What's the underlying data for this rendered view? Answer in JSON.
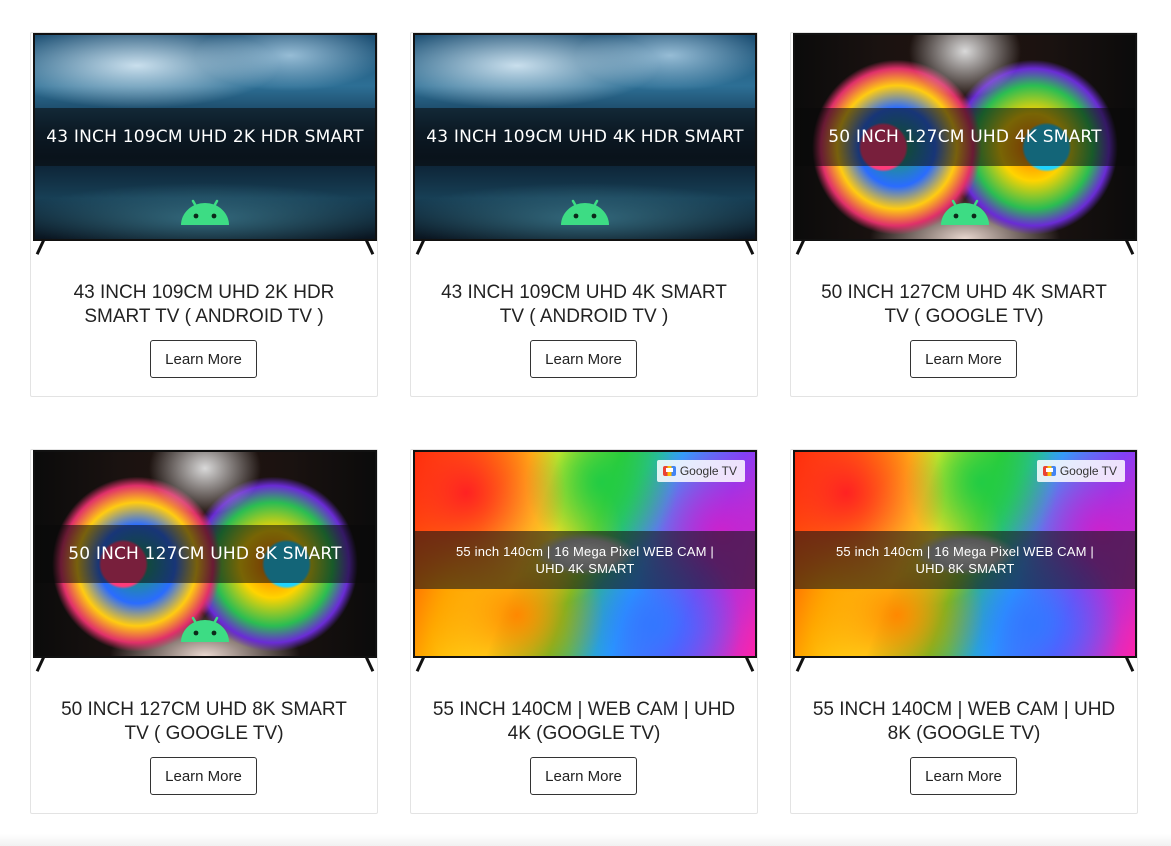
{
  "products": [
    {
      "screen_text": "43 INCH 109CM UHD 2K HDR  SMART",
      "title": "43 INCH 109CM UHD 2K HDR SMART TV ( ANDROID TV )",
      "button": "Learn More"
    },
    {
      "screen_text": "43 INCH 109CM UHD 4K HDR  SMART",
      "title": "43 INCH 109CM UHD 4K SMART TV ( ANDROID TV )",
      "button": "Learn More"
    },
    {
      "screen_text": "50 INCH 127CM UHD 4K SMART",
      "title": "50 INCH 127CM UHD 4K SMART TV ( GOOGLE TV)",
      "button": "Learn More"
    },
    {
      "screen_text": "50 INCH 127CM UHD 8K SMART",
      "title": "50 INCH 127CM UHD 8K SMART TV ( GOOGLE TV)",
      "button": "Learn More"
    },
    {
      "screen_text": "55 inch 140cm | 16 Mega Pixel WEB CAM | UHD 4K SMART",
      "badge": "Google TV",
      "title": "55 INCH 140CM | WEB CAM | UHD 4K (GOOGLE TV)",
      "button": "Learn More"
    },
    {
      "screen_text": "55 inch 140cm | 16 Mega Pixel WEB CAM | UHD 8K SMART",
      "badge": "Google TV",
      "title": "55 INCH 140CM | WEB CAM | UHD 8K (GOOGLE TV)",
      "button": "Learn More"
    }
  ],
  "colors": {
    "android_green": "#3ddc84",
    "button_border": "#333333",
    "card_border": "#e3e3e3"
  }
}
